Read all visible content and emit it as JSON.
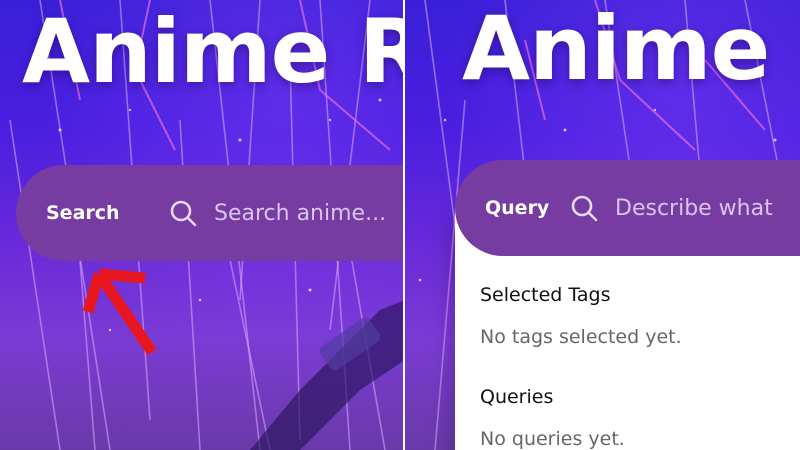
{
  "left": {
    "title": "Anime R",
    "mode_label": "Search",
    "search_placeholder": "Search anime..."
  },
  "right": {
    "title": "Anime",
    "mode_label": "Query",
    "query_placeholder": "Describe what",
    "dropdown": {
      "selected_tags_heading": "Selected Tags",
      "selected_tags_empty": "No tags selected yet.",
      "queries_heading": "Queries",
      "queries_empty": "No queries yet."
    }
  },
  "colors": {
    "search_bar": "#763ca2",
    "annotation_arrow": "#e8161f",
    "background_top": "#3a1fd8",
    "background_bottom": "#7a3bd4"
  },
  "icons": [
    "search-icon",
    "red-arrow-annotation"
  ]
}
